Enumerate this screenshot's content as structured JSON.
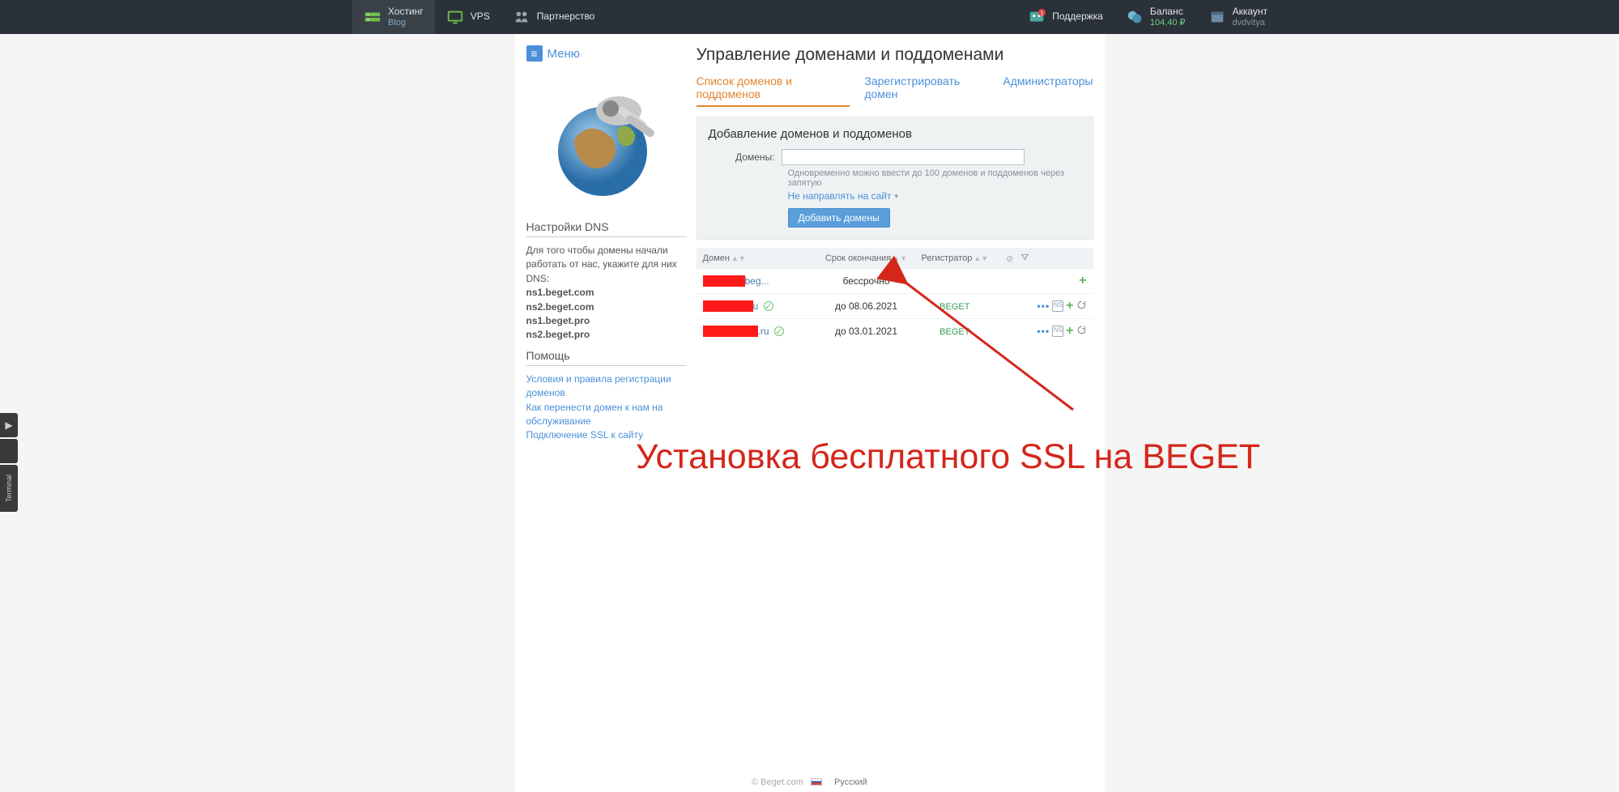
{
  "nav": {
    "hosting": {
      "title": "Хостинг",
      "sub": "Blog"
    },
    "vps": {
      "title": "VPS"
    },
    "partner": {
      "title": "Партнерство"
    },
    "support": {
      "title": "Поддержка"
    },
    "balance": {
      "title": "Баланс",
      "sub": "104,40 ₽"
    },
    "account": {
      "title": "Аккаунт",
      "sub": "dvdvitya"
    }
  },
  "menu_label": "Меню",
  "sidebar": {
    "dns_heading": "Настройки DNS",
    "dns_text": "Для того чтобы домены начали работать от нас, укажите для них DNS:",
    "ns": [
      "ns1.beget.com",
      "ns2.beget.com",
      "ns1.beget.pro",
      "ns2.beget.pro"
    ],
    "help_heading": "Помощь",
    "help_links": [
      "Условия и правила регистрации доменов",
      "Как перенести домен к нам на обслуживание",
      "Подключение SSL к сайту"
    ]
  },
  "page_title": "Управление доменами и поддоменами",
  "tabs": [
    "Список доменов и поддоменов",
    "Зарегистрировать домен",
    "Администраторы"
  ],
  "add_box": {
    "heading": "Добавление доменов и поддоменов",
    "label": "Домены:",
    "hint": "Одновременно можно ввести до 100 доменов и поддоменов через запятую",
    "redirect": "Не направлять на сайт",
    "button": "Добавить домены"
  },
  "table": {
    "headers": {
      "domain": "Домен",
      "exp": "Срок окончания",
      "reg": "Регистратор"
    },
    "rows": [
      {
        "domain_masked_width": 52,
        "domain_suffix": "beg...",
        "exp": "бессрочно",
        "reg": "",
        "actions": [
          "plus"
        ]
      },
      {
        "domain_masked_width": 62,
        "domain_suffix": "u",
        "exp": "до 08.06.2021",
        "reg": "BEGET",
        "check": true,
        "actions": [
          "dots",
          "box",
          "plus",
          "refresh"
        ]
      },
      {
        "domain_masked_width": 68,
        "domain_suffix": ".ru",
        "exp": "до 03.01.2021",
        "reg": "BEGET",
        "check": true,
        "actions": [
          "dots",
          "box",
          "plus",
          "refresh"
        ]
      }
    ]
  },
  "annotation": "Установка бесплатного SSL на BEGET",
  "footer": {
    "copy": "© Beget.com",
    "lang": "Русский"
  },
  "edge": {
    "terminal": "Terminal"
  }
}
